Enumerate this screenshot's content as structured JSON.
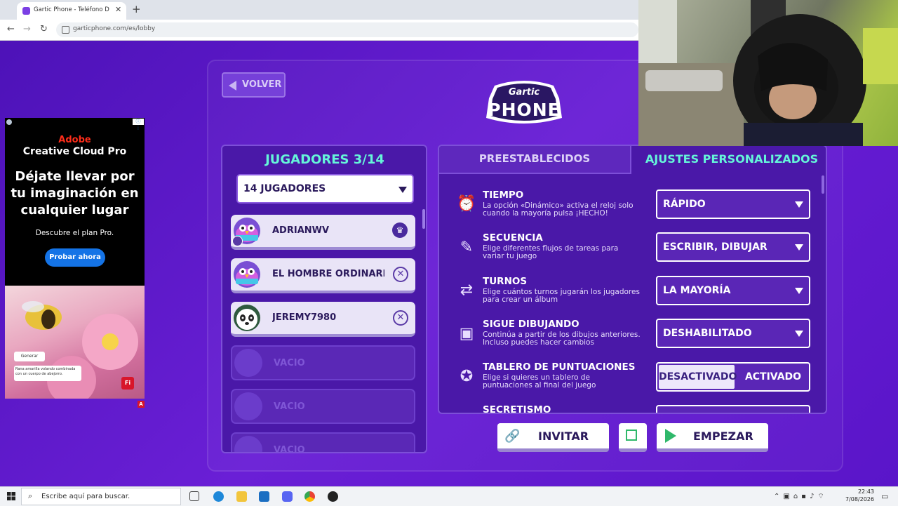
{
  "browser": {
    "tab_title": "Gartic Phone - Teléfono Descon",
    "url": "garticphone.com/es/lobby"
  },
  "lobby": {
    "back_label": "VOLVER",
    "logo_top": "Gartic",
    "logo_main": "PHONE",
    "players_title": "JUGADORES 3/14",
    "players_select": "14 JUGADORES",
    "players": [
      {
        "name": "ADRIANWV",
        "status": "host"
      },
      {
        "name": "EL HOMBRE ORDINARIO",
        "status": "player"
      },
      {
        "name": "JEREMY7980",
        "status": "player"
      },
      {
        "name": "VACÍO",
        "status": "empty"
      },
      {
        "name": "VACÍO",
        "status": "empty"
      },
      {
        "name": "VACÍO",
        "status": "empty"
      }
    ]
  },
  "settings": {
    "tab_preset": "PREESTABLECIDOS",
    "tab_custom": "AJUSTES PERSONALIZADOS",
    "items": [
      {
        "title": "TIEMPO",
        "desc": "La opción «Dinámico» activa el reloj solo cuando la mayoría pulsa ¡HECHO!",
        "value": "RÁPIDO",
        "icon": "alarm-clock-icon"
      },
      {
        "title": "SECUENCIA",
        "desc": "Elige diferentes flujos de tareas para variar tu juego",
        "value": "ESCRIBIR, DIBUJAR",
        "icon": "pencil-speech-icon"
      },
      {
        "title": "TURNOS",
        "desc": "Elige cuántos turnos jugarán los jugadores para crear un álbum",
        "value": "LA MAYORÍA",
        "icon": "turns-arrows-icon"
      },
      {
        "title": "SIGUE DIBUJANDO",
        "desc": "Continúa a partir de los dibujos anteriores. Incluso puedes hacer cambios",
        "value": "DESHABILITADO",
        "icon": "drawing-image-icon"
      },
      {
        "title": "TABLERO DE PUNTUACIONES",
        "desc": "Elige si quieres un tablero de puntuaciones al final del juego",
        "toggle_off": "DESACTIVADO",
        "toggle_on": "ACTIVADO",
        "icon": "medal-icon"
      },
      {
        "title": "SECRETISMO",
        "icon": "eye-icon"
      }
    ]
  },
  "actions": {
    "invite": "INVITAR",
    "start": "EMPEZAR"
  },
  "ad": {
    "brand": "Adobe",
    "product": "Creative Cloud Pro",
    "headline": "Déjate llevar por tu imaginación en cualquier lugar",
    "sub": "Descubre el plan Pro.",
    "cta": "Probar ahora",
    "gen_button": "Generar",
    "prompt": "Rana amarilla volando combinada con un cuerpo de abejorro.",
    "fi_badge": "Fi",
    "a_badge": "A"
  },
  "taskbar": {
    "search_placeholder": "Escribe aquí para buscar.",
    "time": "22:43",
    "date": "7/08/2026"
  },
  "colors": {
    "accent_teal": "#65f5d9",
    "panel": "#4a18a8",
    "background": "#5b17c4"
  }
}
